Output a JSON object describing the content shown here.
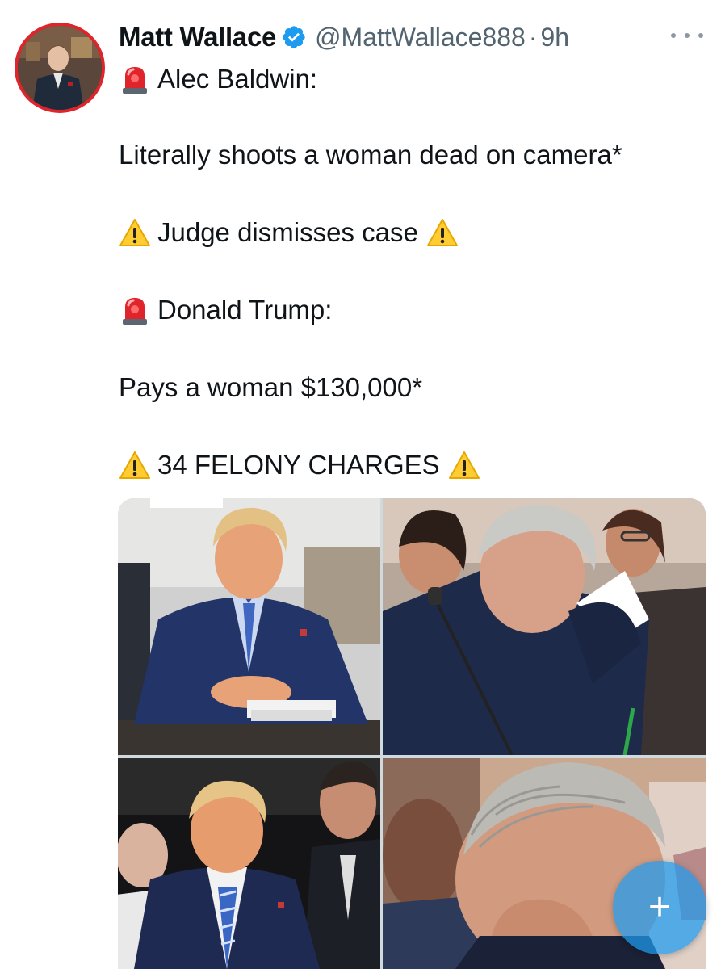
{
  "author": {
    "display_name": "Matt Wallace",
    "handle": "@MattWallace888",
    "separator": "·",
    "time": "9h",
    "verified": true,
    "verified_color": "#1d9bf0"
  },
  "tweet": {
    "lines": [
      {
        "emoji_before": "rotating-light-icon",
        "text": "Alec Baldwin:"
      },
      {
        "text": "Literally shoots a woman dead on camera*"
      },
      {
        "emoji_before": "warning-icon",
        "text": "Judge dismisses case",
        "emoji_after": "warning-icon"
      },
      {
        "emoji_before": "rotating-light-icon",
        "text": "Donald Trump:"
      },
      {
        "text": "Pays a woman $130,000*"
      },
      {
        "emoji_before": "warning-icon",
        "text": "34 FELONY CHARGES",
        "emoji_after": "warning-icon"
      }
    ]
  },
  "media": {
    "photos": [
      {
        "subject": "man in navy suit and blue tie seated at courtroom table"
      },
      {
        "subject": "gray-haired man embracing a woman in courtroom"
      },
      {
        "subject": "man in navy suit with blue striped tie walking with aides"
      },
      {
        "subject": "gray-haired man with head down, hands to face"
      }
    ]
  },
  "compose_button": {
    "label": "+",
    "color": "#1d9bf0"
  },
  "colors": {
    "text": "#0f1419",
    "secondary": "#536471",
    "avatar_ring": "#e0242c"
  }
}
